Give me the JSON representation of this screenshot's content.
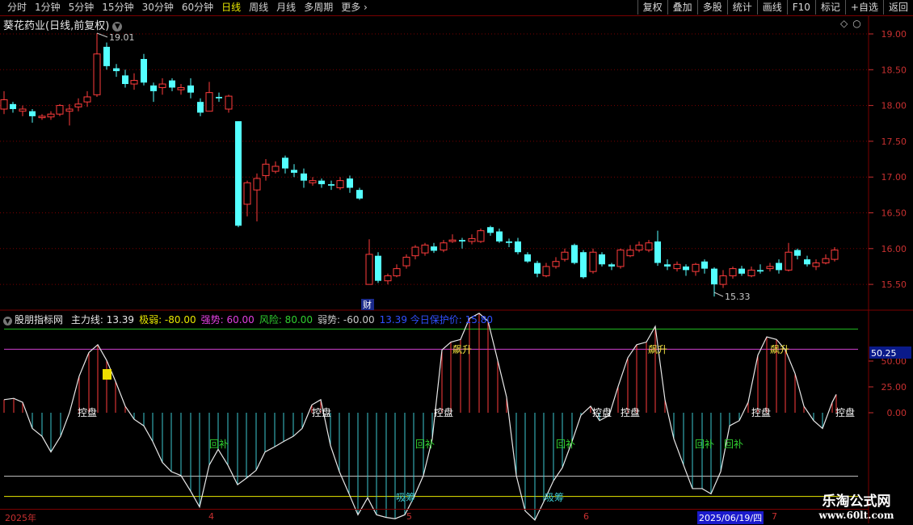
{
  "toolbar": {
    "periods": [
      "分时",
      "1分钟",
      "5分钟",
      "15分钟",
      "30分钟",
      "60分钟",
      "日线",
      "周线",
      "月线",
      "多周期",
      "更多"
    ],
    "active_period": "日线",
    "right_buttons": [
      "复权",
      "叠加",
      "多股",
      "统计",
      "画线",
      "F10",
      "标记",
      "+自选",
      "返回"
    ]
  },
  "stock": {
    "title": "葵花药业(日线,前复权)"
  },
  "price_axis": {
    "ticks": [
      "19.00",
      "18.50",
      "18.00",
      "17.50",
      "17.00",
      "16.50",
      "16.00",
      "15.50"
    ]
  },
  "price_annotations": {
    "high": "19.01",
    "low": "15.33",
    "cai_label": "财"
  },
  "indicator": {
    "name": "股朋指标网",
    "items": [
      {
        "label": "主力线: 13.39",
        "color": "#e8e8e8"
      },
      {
        "label": "极弱: -80.00",
        "color": "#e8e800"
      },
      {
        "label": "强势: 60.00",
        "color": "#e040e0"
      },
      {
        "label": "风险: 80.00",
        "color": "#30d030"
      },
      {
        "label": "弱势: -60.00",
        "color": "#c8c8c8"
      },
      {
        "label": "13.39  今日保护价: 15.80",
        "color": "#3050ff"
      }
    ],
    "axis_ticks": [
      "50.00",
      "25.00",
      "0.00"
    ],
    "current_value_box": "50.25",
    "signals": {
      "kongpan": "控盘",
      "piaosheng": "飙升",
      "huibu": "回补",
      "xichou": "吸筹"
    }
  },
  "dates": {
    "year": "2025年",
    "months": [
      "4",
      "5",
      "6",
      "7"
    ],
    "highlight": "2025/06/19/四"
  },
  "watermark": {
    "line1": "乐淘公式网",
    "line2": "www.60lt.com"
  },
  "colors": {
    "up": "#ff3c3c",
    "down": "#54ffff",
    "bg": "#000000",
    "grid": "#7a0000"
  }
}
